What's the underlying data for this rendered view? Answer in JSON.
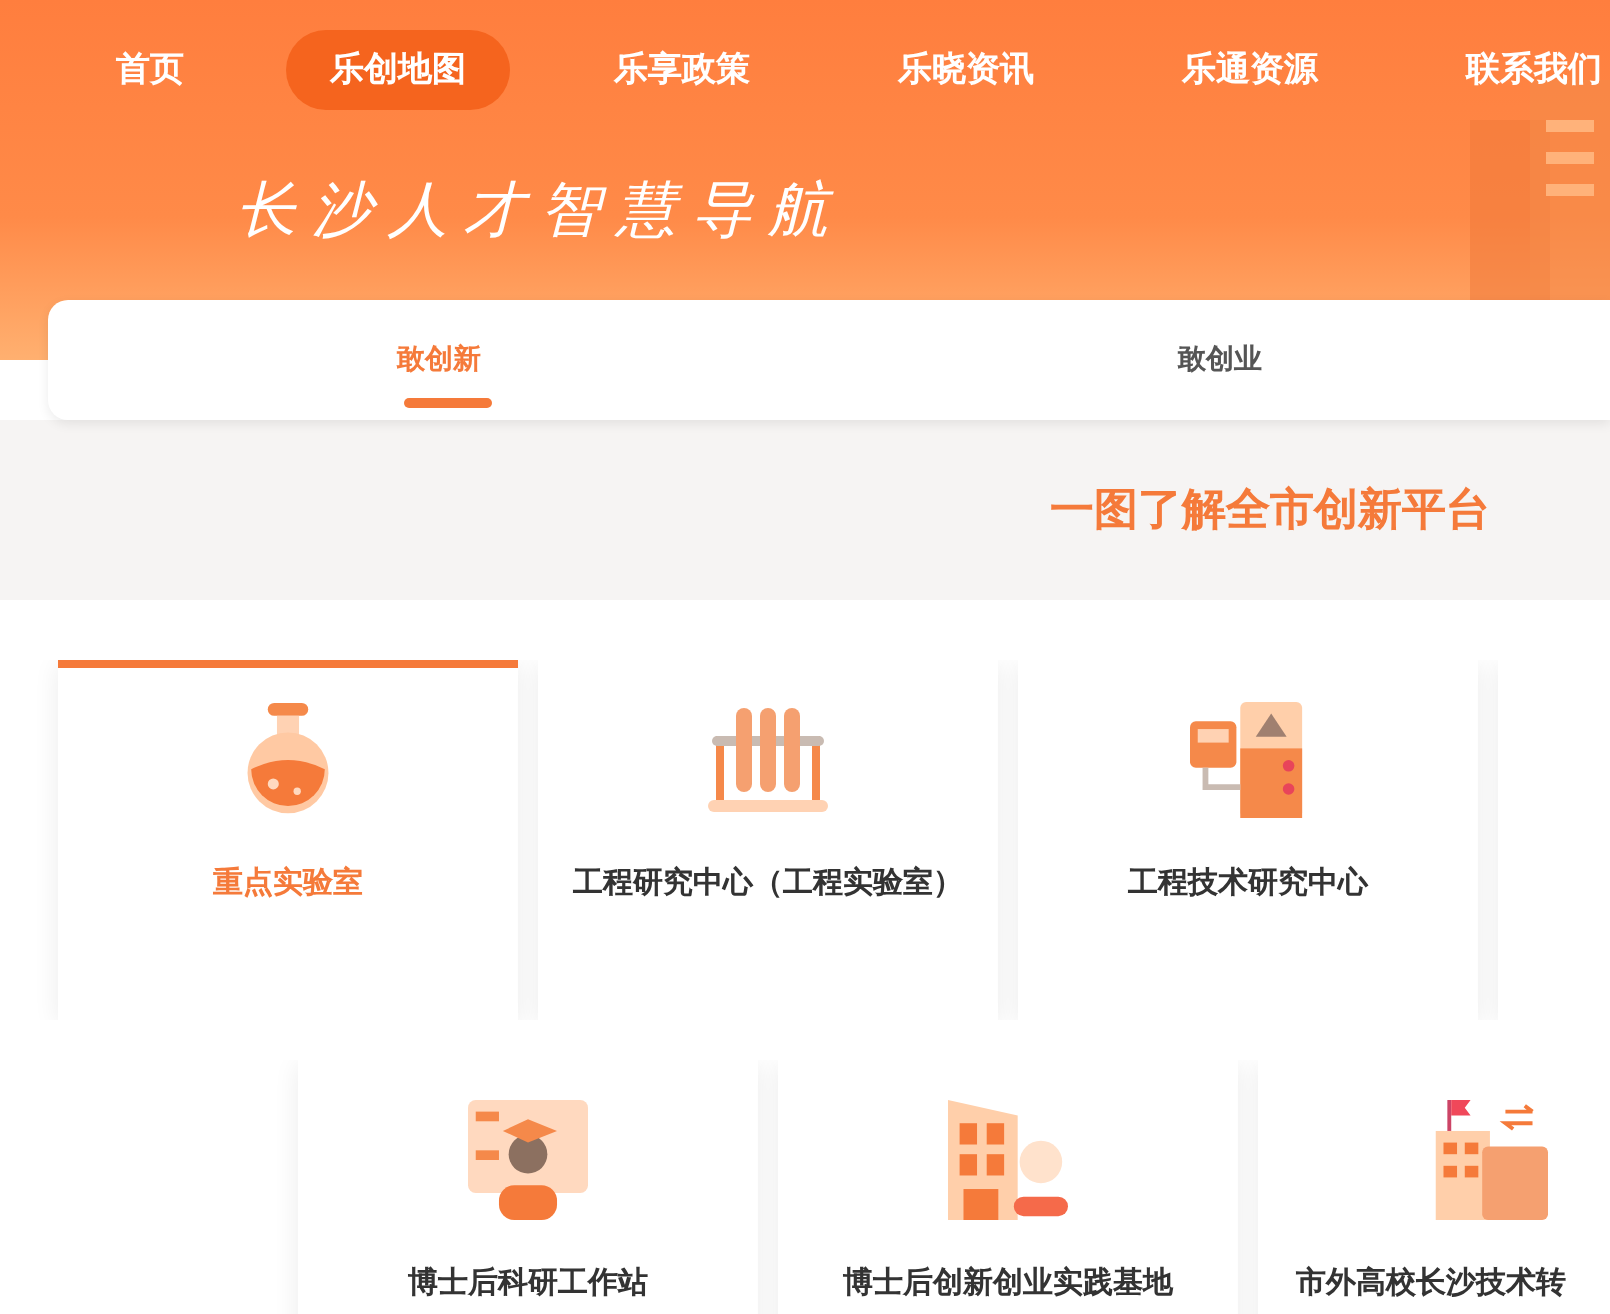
{
  "nav": [
    {
      "label": "首页",
      "selected": false
    },
    {
      "label": "乐创地图",
      "selected": true
    },
    {
      "label": "乐享政策",
      "selected": false
    },
    {
      "label": "乐晓资讯",
      "selected": false
    },
    {
      "label": "乐通资源",
      "selected": false
    },
    {
      "label": "联系我们",
      "selected": false
    }
  ],
  "banner": {
    "title": "长沙人才智慧导航"
  },
  "tabs": [
    {
      "label": "敢创新",
      "selected": true
    },
    {
      "label": "敢创业",
      "selected": false
    }
  ],
  "headline": "一图了解全市创新平台",
  "rows": [
    [
      {
        "kind": "flask",
        "label": "重点实验室",
        "selected": true
      },
      {
        "kind": "tubes",
        "label": "工程研究中心（工程实验室）",
        "selected": false
      },
      {
        "kind": "device",
        "label": "工程技术研究中心",
        "selected": false
      },
      {
        "kind": "blank",
        "selected": false
      }
    ],
    [
      {
        "kind": "scholar",
        "label": "博士后科研工作站",
        "selected": false
      },
      {
        "kind": "building",
        "label": "博士后创新创业实践基地",
        "selected": false
      },
      {
        "kind": "transfer",
        "label": "市外高校长沙技术转",
        "selected": false
      }
    ]
  ]
}
